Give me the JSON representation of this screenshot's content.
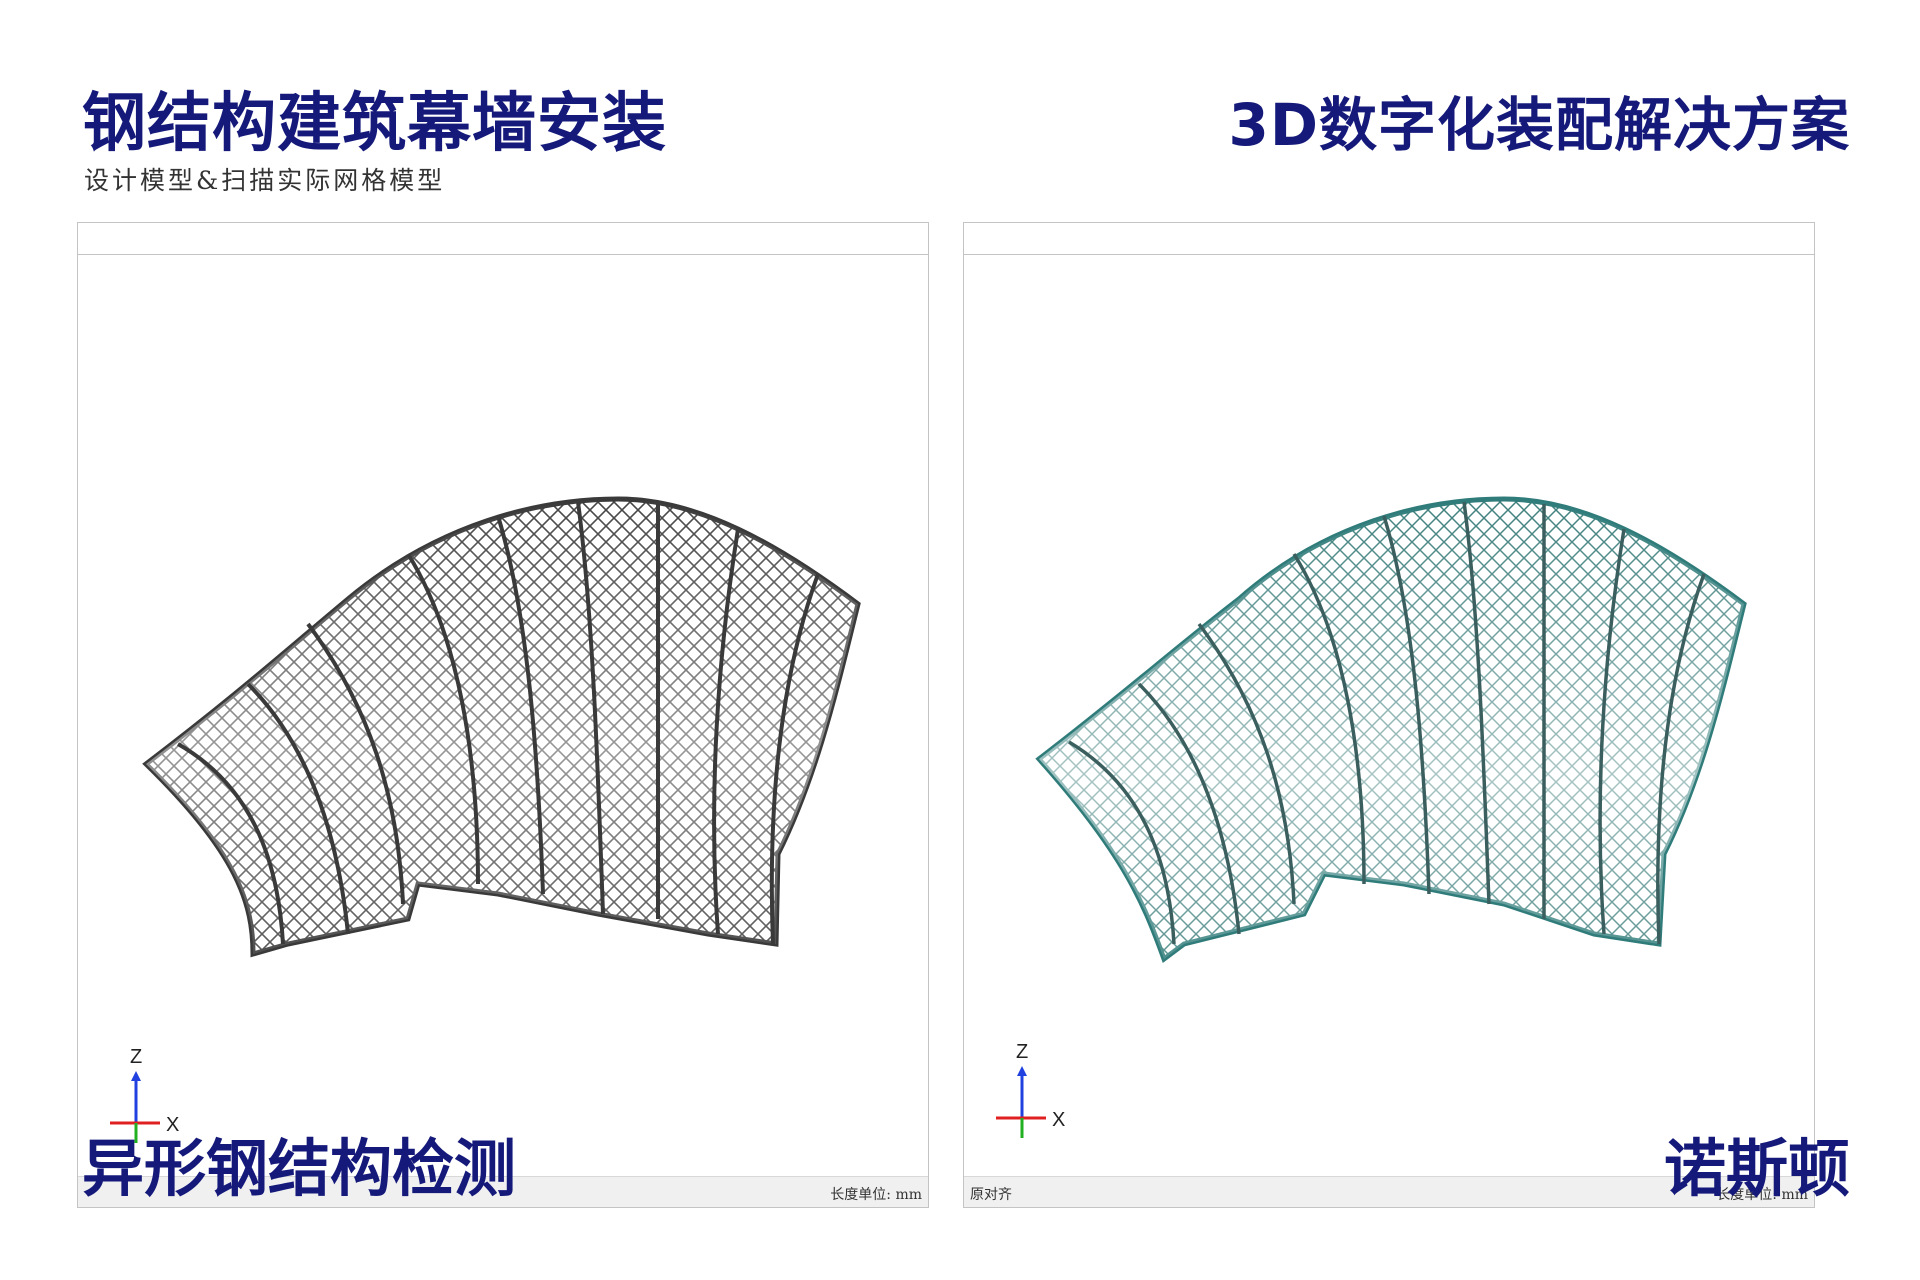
{
  "header": {
    "title_left": "钢结构建筑幕墙安装",
    "subtitle_left": "设计模型&扫描实际网格模型",
    "title_right": "3D数字化装配解决方案"
  },
  "viewports": [
    {
      "status_left": "",
      "status_right": "长度单位: mm",
      "model_color": "#3a3a3a",
      "axis_labels": {
        "x": "X",
        "z": "Z"
      }
    },
    {
      "status_left": "原对齐",
      "status_right": "长度单位: mm",
      "model_color": "#2f7c7a",
      "axis_labels": {
        "x": "X",
        "z": "Z"
      }
    }
  ],
  "footer": {
    "label_left": "异形钢结构检测",
    "label_right": "诺斯顿"
  },
  "colors": {
    "brand": "#14197a",
    "axis_x": "#e02020",
    "axis_y": "#20b020",
    "axis_z": "#2040e0"
  }
}
